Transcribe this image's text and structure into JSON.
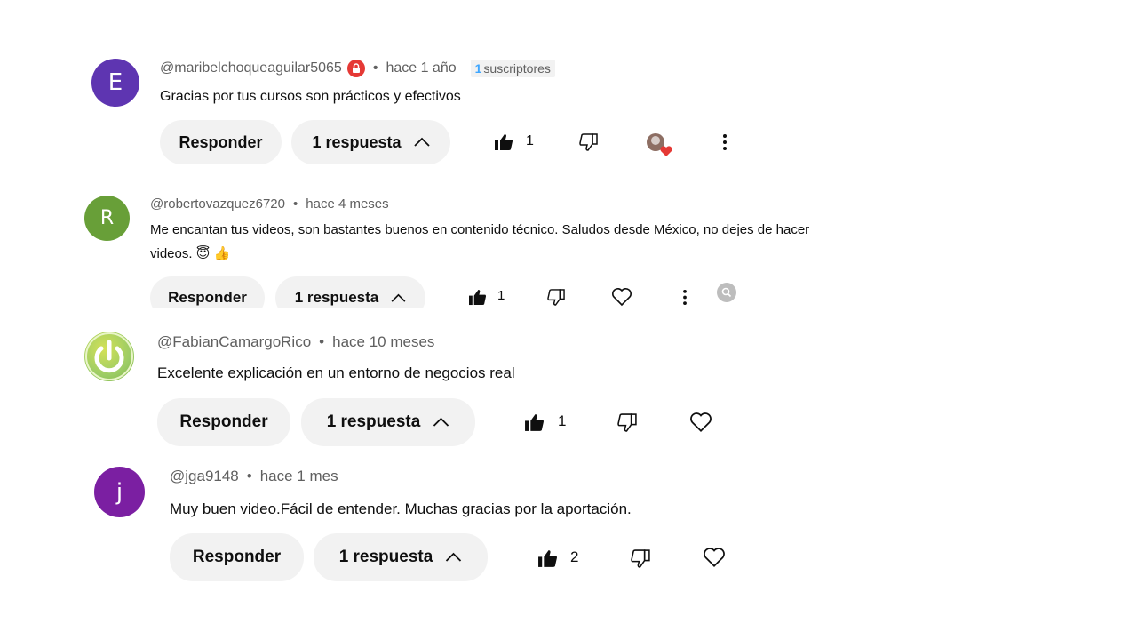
{
  "comments": [
    {
      "avatar_letter": "E",
      "avatar_color": "#5e35b1",
      "handle": "@maribelchoqueaguilar5065",
      "time": "hace 1 año",
      "badge_count": "1",
      "badge_text": "suscriptores",
      "text": "Gracias por tus cursos son prácticos y efectivos",
      "reply_label": "Responder",
      "replies_label": "1 respuesta",
      "likes": "1"
    },
    {
      "avatar_letter": "R",
      "avatar_color": "#689f38",
      "handle": "@robertovazquez6720",
      "time": "hace 4 meses",
      "text_line1": "Me encantan tus videos, son bastantes buenos en contenido técnico. Saludos desde México, no dejes de hacer",
      "text_line2": "videos. 😇 👍",
      "reply_label": "Responder",
      "replies_label": "1 respuesta",
      "likes": "1"
    },
    {
      "avatar_icon": "power-icon",
      "avatar_color": "#a4c639",
      "handle": "@FabianCamargoRico",
      "time": "hace 10 meses",
      "text": "Excelente explicación en un entorno de negocios real",
      "reply_label": "Responder",
      "replies_label": "1 respuesta",
      "likes": "1"
    },
    {
      "avatar_letter": "j",
      "avatar_color": "#7b1fa2",
      "handle": "@jga9148",
      "time": "hace 1 mes",
      "text": "Muy buen video.Fácil de entender. Muchas gracias por la aportación.",
      "reply_label": "Responder",
      "replies_label": "1 respuesta",
      "likes": "2"
    }
  ],
  "colors": {
    "pill_bg": "#f2f2f2",
    "meta_text": "#606060",
    "badge_accent": "#3ea6ff",
    "heart_red": "#e53935"
  }
}
